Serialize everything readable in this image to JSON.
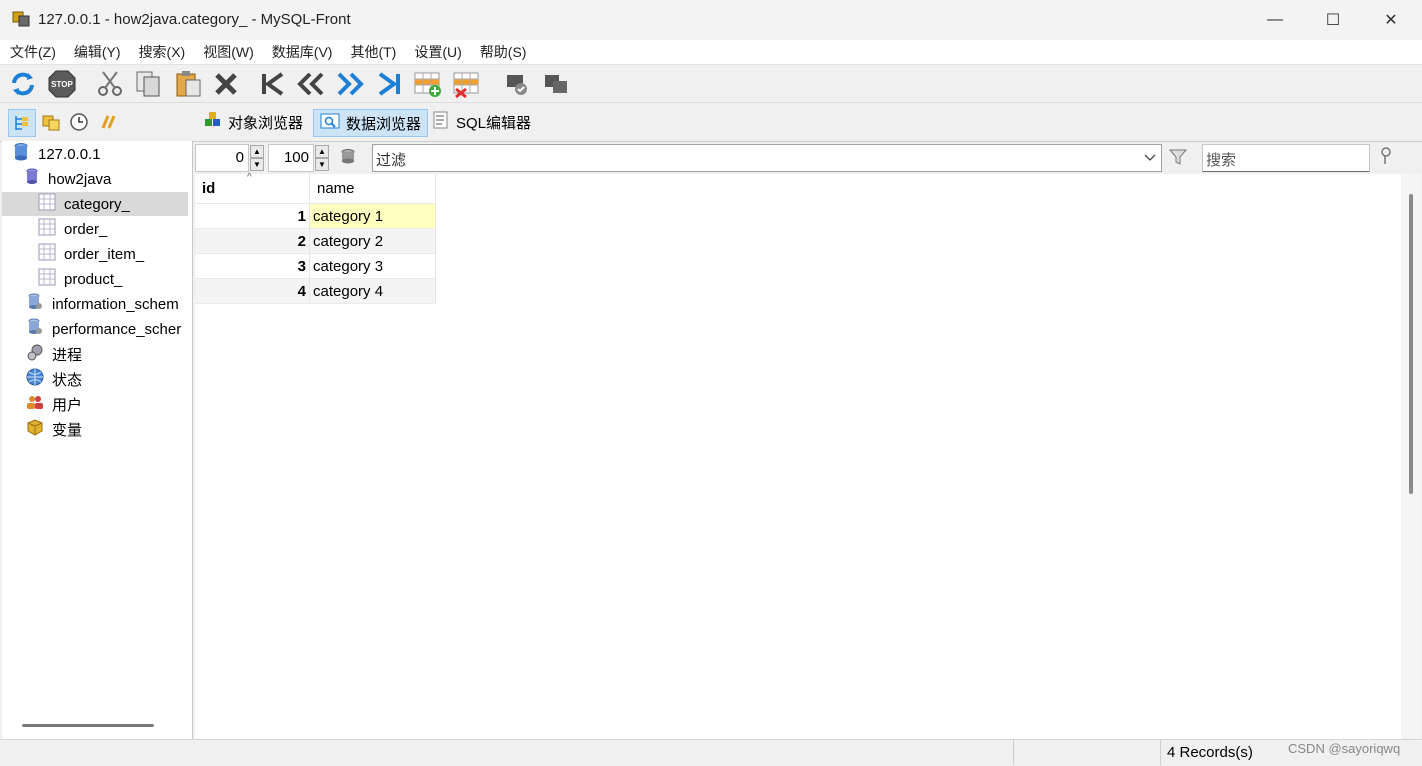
{
  "window": {
    "title": "127.0.0.1 - how2java.category_ - MySQL-Front",
    "minimize": "—",
    "maximize": "☐",
    "close": "✕"
  },
  "menu": [
    "文件(Z)",
    "编辑(Y)",
    "搜索(X)",
    "视图(W)",
    "数据库(V)",
    "其他(T)",
    "设置(U)",
    "帮助(S)"
  ],
  "toolbar_icons": [
    "refresh-icon",
    "stop-icon",
    "cut-icon",
    "copy-icon",
    "paste-icon",
    "delete-icon",
    "first-icon",
    "prior-icon",
    "next-icon",
    "last-icon",
    "insert-record-icon",
    "delete-record-icon",
    "post-icon",
    "cancel-icon"
  ],
  "viewbar": {
    "tabs": [
      {
        "label": "对象浏览器",
        "icon": "object-browser-icon",
        "active": false
      },
      {
        "label": "数据浏览器",
        "icon": "data-browser-icon",
        "active": true
      },
      {
        "label": "SQL编辑器",
        "icon": "sql-editor-icon",
        "active": false
      }
    ]
  },
  "tree": {
    "server": "127.0.0.1",
    "database": "how2java",
    "tables": [
      "category_",
      "order_",
      "order_item_",
      "product_"
    ],
    "selected_table": "category_",
    "schemas": [
      "information_schem",
      "performance_scher"
    ],
    "others": [
      {
        "label": "进程",
        "icon": "processes-icon"
      },
      {
        "label": "状态",
        "icon": "status-icon"
      },
      {
        "label": "用户",
        "icon": "users-icon"
      },
      {
        "label": "变量",
        "icon": "variables-icon"
      }
    ]
  },
  "filter_row": {
    "offset": "0",
    "limit": "100",
    "filter_placeholder": "过滤",
    "search_placeholder": "搜索"
  },
  "grid": {
    "columns": [
      "id",
      "name"
    ],
    "rows": [
      {
        "id": "1",
        "name": "category 1"
      },
      {
        "id": "2",
        "name": "category 2"
      },
      {
        "id": "3",
        "name": "category 3"
      },
      {
        "id": "4",
        "name": "category 4"
      }
    ],
    "selected_row": 0
  },
  "status": {
    "records": "4 Records(s)",
    "watermark": "CSDN @sayoriqwq"
  },
  "colors": {
    "selected_cell": "#ffffc0",
    "active_tab": "#cde4f7",
    "accent_blue": "#1e7fd6"
  }
}
